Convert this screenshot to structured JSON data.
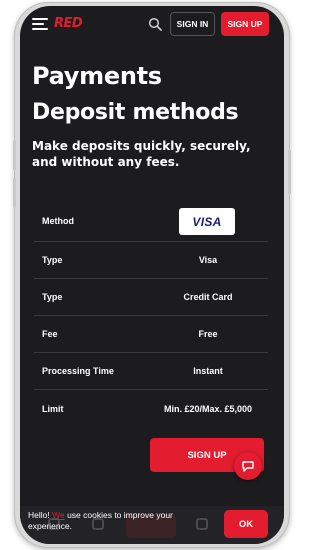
{
  "header": {
    "logo": "RED",
    "sign_in": "SIGN IN",
    "sign_up": "SIGN UP"
  },
  "page": {
    "title": "Payments",
    "subtitle": "Deposit methods",
    "description": "Make deposits quickly, securely, and without any fees."
  },
  "method": {
    "label": "Method",
    "logo_text": "VISA"
  },
  "rows": [
    {
      "label": "Type",
      "value": "Visa"
    },
    {
      "label": "Type",
      "value": "Credit Card"
    },
    {
      "label": "Fee",
      "value": "Free"
    },
    {
      "label": "Processing Time",
      "value": "Instant"
    },
    {
      "label": "Limit",
      "value": "Min. £20/Max. £5,000"
    }
  ],
  "cta": {
    "label": "SIGN UP"
  },
  "cookie": {
    "prefix": "Hello! ",
    "link": "We",
    "suffix": " use cookies to improve your experience.",
    "ok": "OK"
  },
  "colors": {
    "accent": "#e31d2f",
    "background": "#1c1b1e"
  }
}
